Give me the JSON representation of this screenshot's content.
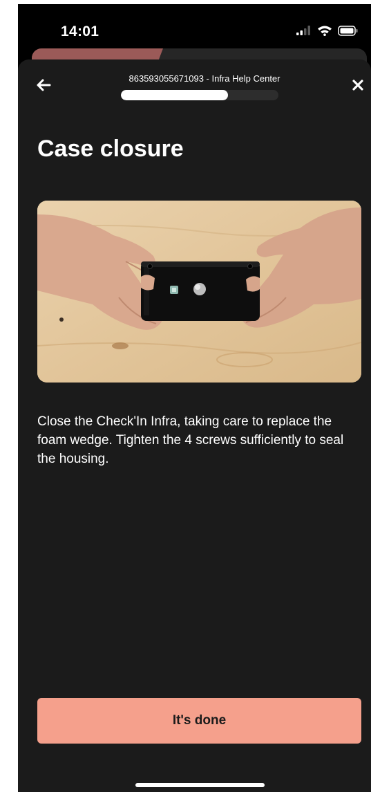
{
  "status_bar": {
    "time": "14:01",
    "icons": [
      "signal-icon",
      "wifi-icon",
      "battery-icon"
    ]
  },
  "header": {
    "title": "863593055671093 - Infra Help Center",
    "back_icon": "arrow-left-icon",
    "close_icon": "close-icon",
    "progress": 0.68
  },
  "main": {
    "title": "Case closure",
    "image_alt": "Hands holding a black Check'In Infra device case on a wooden table",
    "description": "Close the Check'In Infra, taking care to replace the foam wedge. Tighten the 4 screws sufficiently to seal the housing."
  },
  "footer": {
    "done_label": "It's done"
  },
  "colors": {
    "background": "#1b1b1b",
    "accent": "#f5a08c",
    "text": "#ffffff",
    "progress_track": "#2d2d2d"
  }
}
